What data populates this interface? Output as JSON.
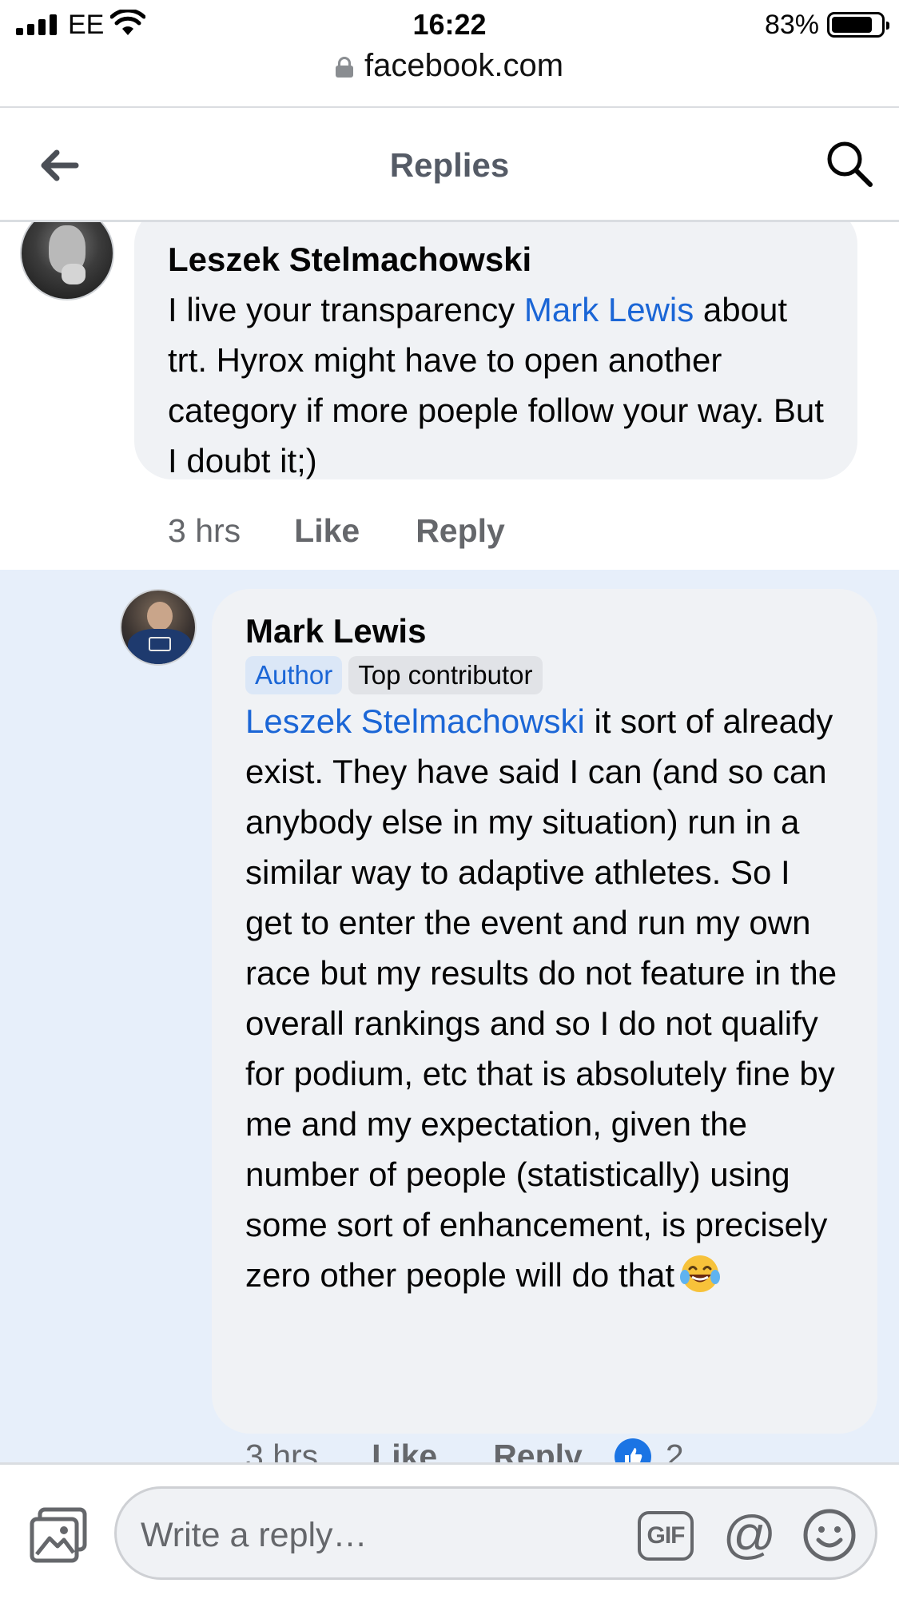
{
  "status_bar": {
    "carrier": "EE",
    "time": "16:22",
    "battery_percent": "83%",
    "battery_level": 0.83
  },
  "browser": {
    "url": "facebook.com"
  },
  "header": {
    "title": "Replies",
    "back_icon": "back-arrow-icon",
    "search_icon": "search-icon"
  },
  "comments": [
    {
      "author": "Leszek Stelmachowski",
      "text_before_mention": "I live your transparency ",
      "mention": "Mark Lewis",
      "text_after_mention": " about trt. Hyrox might have to open another category if more poeple follow your way. But I doubt it;)",
      "time": "3 hrs",
      "like_label": "Like",
      "reply_label": "Reply"
    },
    {
      "author": "Mark Lewis",
      "badges": [
        "Author",
        "Top contributor"
      ],
      "mention": "Leszek Stelmachowski",
      "text_after_mention": " it sort of already exist. They have said I can (and so can anybody else in my situation) run in a similar way to adaptive athletes. So I get to enter the event and run my own race but my results do not feature in the overall rankings and so I do not qualify for podium, etc that is absolutely fine by me and my expectation, given the number of people (statistically) using some sort of enhancement, is precisely zero other people will do that",
      "emoji": "face-with-tears-of-joy-icon",
      "time": "3 hrs",
      "like_label": "Like",
      "reply_label": "Reply",
      "reaction_count": "2"
    }
  ],
  "composer": {
    "placeholder": "Write a reply…",
    "gif_label": "GIF",
    "mention_label": "@"
  },
  "colors": {
    "link_blue": "#1b66d6",
    "bubble_gray": "#f0f2f5",
    "highlight_blue": "#e7effa",
    "meta_gray": "#65676b"
  }
}
